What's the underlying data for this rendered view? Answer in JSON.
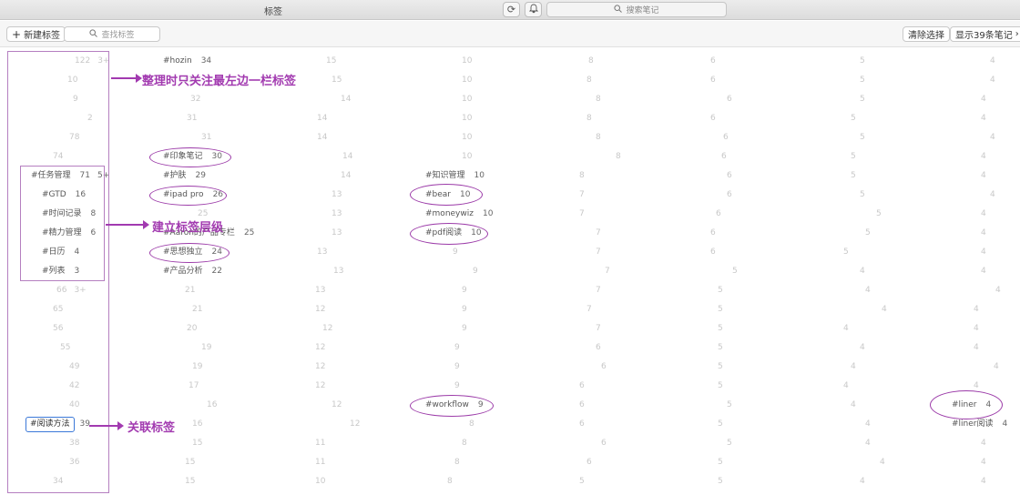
{
  "window": {
    "title": "标签",
    "search_placeholder": "搜索笔记"
  },
  "toolbar": {
    "new_tag_label": "新建标签",
    "tag_search_placeholder": "查找标签",
    "clear_selection_label": "清除选择",
    "show_notes_label": "显示39条笔记"
  },
  "annotations": {
    "note1": "整理时只关注最左边一栏标签",
    "note2": "建立标签层级",
    "note3": "关联标签"
  },
  "readable_tags": {
    "hozin": {
      "name": "#hozin",
      "count": "34"
    },
    "yinxiang": {
      "name": "#印象笔记",
      "count": "30"
    },
    "hufu": {
      "name": "#护肤",
      "count": "29"
    },
    "ipad": {
      "name": "#ipad pro",
      "count": "26"
    },
    "aaron": {
      "name": "#Aaron的产品专栏",
      "count": "25"
    },
    "sixiang": {
      "name": "#思想独立",
      "count": "24"
    },
    "chanpin": {
      "name": "#产品分析",
      "count": "22"
    },
    "renwu": {
      "name": "#任务管理",
      "count": "71",
      "extra": "5+"
    },
    "gtd": {
      "name": "#GTD",
      "count": "16"
    },
    "shijian": {
      "name": "#时间记录",
      "count": "8"
    },
    "jingli": {
      "name": "#精力管理",
      "count": "6"
    },
    "rili": {
      "name": "#日历",
      "count": "4"
    },
    "liebiao": {
      "name": "#列表",
      "count": "3"
    },
    "yuedu": {
      "name": "#阅读方法",
      "count": "39"
    },
    "bear": {
      "name": "#bear",
      "count": "10"
    },
    "moneywiz": {
      "name": "#moneywiz",
      "count": "10"
    },
    "pdf": {
      "name": "#pdf阅读",
      "count": "10"
    },
    "workflow": {
      "name": "#workflow",
      "count": "9"
    },
    "liner": {
      "name": "#liner",
      "count": "4"
    },
    "linerread": {
      "name": "#liner阅读",
      "count": "4"
    },
    "zhishi": {
      "name": "#知识管理",
      "count": "10"
    }
  },
  "icons": {
    "plus": "plus-icon",
    "search": "magnifier-icon",
    "refresh": "refresh-icon",
    "bell": "bell-icon",
    "chevron": "chevron-right-icon"
  }
}
